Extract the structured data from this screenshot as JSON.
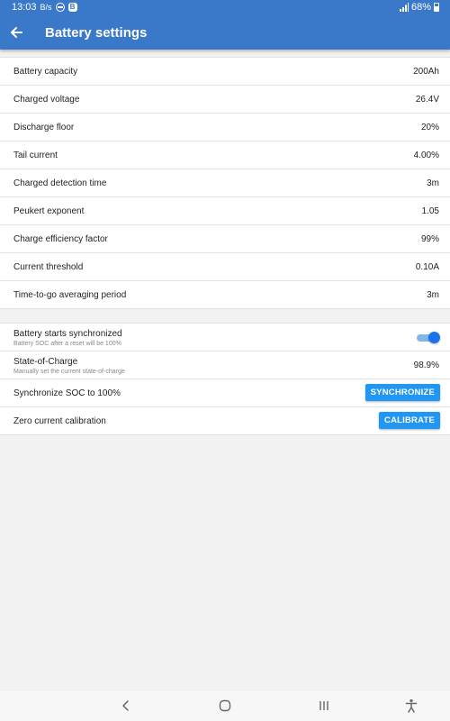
{
  "status_bar": {
    "time": "13:03",
    "battery_percent": "68%",
    "icons": [
      "data-speed-icon",
      "do-not-disturb-icon",
      "b-badge-icon",
      "signal-icon",
      "battery-icon"
    ],
    "badge_letter": "B"
  },
  "app_bar": {
    "title": "Battery settings",
    "back_icon": "arrow-left-icon"
  },
  "settings": [
    {
      "label": "Battery capacity",
      "value": "200Ah"
    },
    {
      "label": "Charged voltage",
      "value": "26.4V"
    },
    {
      "label": "Discharge floor",
      "value": "20%"
    },
    {
      "label": "Tail current",
      "value": "4.00%"
    },
    {
      "label": "Charged detection time",
      "value": "3m"
    },
    {
      "label": "Peukert exponent",
      "value": "1.05"
    },
    {
      "label": "Charge efficiency factor",
      "value": "99%"
    },
    {
      "label": "Current threshold",
      "value": "0.10A"
    },
    {
      "label": "Time-to-go averaging period",
      "value": "3m"
    }
  ],
  "actions": {
    "sync_start": {
      "label": "Battery starts synchronized",
      "sublabel": "Battery SOC after a reset will be 100%",
      "enabled": true
    },
    "soc": {
      "label": "State-of-Charge",
      "sublabel": "Manually set the current state-of-charge",
      "value": "98.9%"
    },
    "sync_soc": {
      "label": "Synchronize SOC to 100%",
      "button": "SYNCHRONIZE"
    },
    "zero_cal": {
      "label": "Zero current calibration",
      "button": "CALIBRATE"
    }
  },
  "nav_bar": {
    "icons": [
      "back-nav-icon",
      "home-nav-icon",
      "recents-nav-icon",
      "accessibility-icon"
    ]
  },
  "colors": {
    "primary": "#3a78c9",
    "button": "#2196f3",
    "toggle_on": "#1a73e8"
  }
}
